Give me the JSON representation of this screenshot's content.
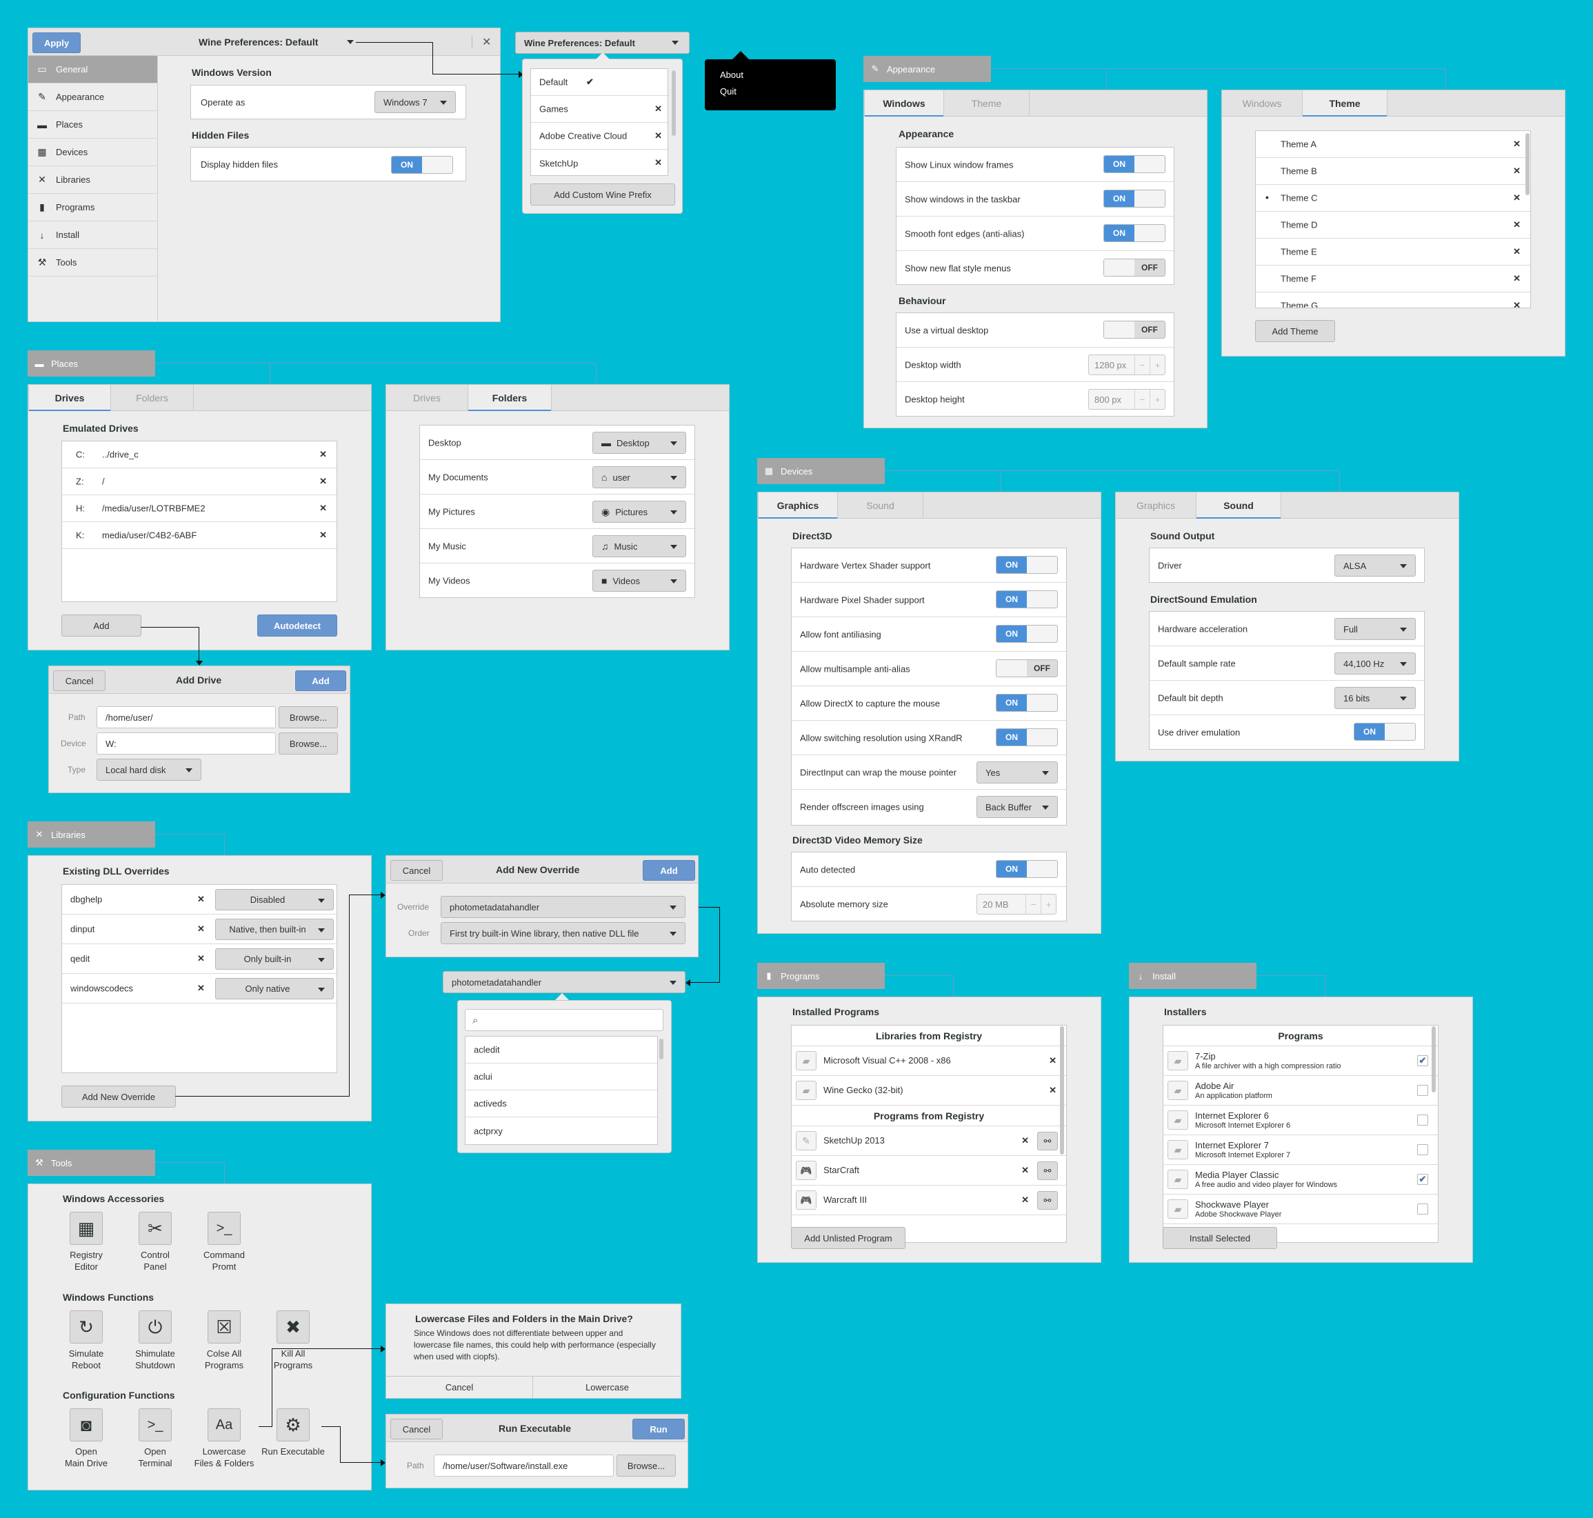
{
  "main_window": {
    "apply": "Apply",
    "title": "Wine Preferences: Default",
    "sidebar": [
      {
        "icon": "monitor-icon",
        "glyph": "▭",
        "label": "General"
      },
      {
        "icon": "brush-icon",
        "glyph": "✎",
        "label": "Appearance"
      },
      {
        "icon": "folder-icon",
        "glyph": "▬",
        "label": "Places"
      },
      {
        "icon": "devices-icon",
        "glyph": "▦",
        "label": "Devices"
      },
      {
        "icon": "tools-icon",
        "glyph": "✕",
        "label": "Libraries"
      },
      {
        "icon": "bag-icon",
        "glyph": "▮",
        "label": "Programs"
      },
      {
        "icon": "download-icon",
        "glyph": "↓",
        "label": "Install"
      },
      {
        "icon": "hammer-icon",
        "glyph": "⚒",
        "label": "Tools"
      }
    ],
    "windows_version": "Windows Version",
    "operate_as": "Operate as",
    "version_value": "Windows 7",
    "hidden_files": "Hidden Files",
    "display_hidden": "Display hidden files",
    "on": "ON"
  },
  "prefix_popover": {
    "button": "Wine Preferences: Default",
    "items": [
      "Default",
      "Games",
      "Adobe Creative Cloud",
      "SketchUp"
    ],
    "check": "✔",
    "add": "Add Custom Wine Prefix"
  },
  "app_menu": {
    "items": [
      "About",
      "Quit"
    ]
  },
  "appearance": {
    "head": "Appearance",
    "tab_windows": "Windows",
    "tab_theme": "Theme",
    "sect_appearance": "Appearance",
    "rows": [
      {
        "label": "Show Linux window frames",
        "state": "ON"
      },
      {
        "label": "Show windows in the taskbar",
        "state": "ON"
      },
      {
        "label": "Smooth font edges (anti-alias)",
        "state": "ON"
      },
      {
        "label": "Show new flat style menus",
        "state": "OFF"
      }
    ],
    "sect_behaviour": "Behaviour",
    "virtual_desktop": "Use a virtual desktop",
    "off": "OFF",
    "desk_width": "Desktop width",
    "width_value": "1280 px",
    "desk_height": "Desktop height",
    "height_value": "800 px",
    "minus": "−",
    "plus": "+",
    "themes": [
      "Theme A",
      "Theme B",
      "Theme C",
      "Theme D",
      "Theme E",
      "Theme F",
      "Theme G"
    ],
    "theme_bullet": "•",
    "add_theme": "Add Theme"
  },
  "places": {
    "head": "Places",
    "tab_drives": "Drives",
    "tab_folders": "Folders",
    "emulated": "Emulated Drives",
    "drives": [
      {
        "letter": "C:",
        "path": "../drive_c"
      },
      {
        "letter": "Z:",
        "path": "/"
      },
      {
        "letter": "H:",
        "path": "/media/user/LOTRBFME2"
      },
      {
        "letter": "K:",
        "path": "media/user/C4B2-6ABF"
      }
    ],
    "add": "Add",
    "autodetect": "Autodetect",
    "folders": [
      {
        "label": "Desktop",
        "value": "Desktop",
        "glyph": "▬"
      },
      {
        "label": "My Documents",
        "value": "user",
        "glyph": "⌂"
      },
      {
        "label": "My Pictures",
        "value": "Pictures",
        "glyph": "◉"
      },
      {
        "label": "My Music",
        "value": "Music",
        "glyph": "♫"
      },
      {
        "label": "My Videos",
        "value": "Videos",
        "glyph": "■"
      }
    ]
  },
  "add_drive": {
    "cancel": "Cancel",
    "title": "Add Drive",
    "add": "Add",
    "path_label": "Path",
    "path_value": "/home/user/",
    "browse": "Browse...",
    "device_label": "Device",
    "device_value": "W:",
    "type_label": "Type",
    "type_value": "Local hard disk"
  },
  "libraries": {
    "head": "Libraries",
    "existing": "Existing DLL Overrides",
    "overrides": [
      {
        "name": "dbghelp",
        "mode": "Disabled"
      },
      {
        "name": "dinput",
        "mode": "Native, then built-in"
      },
      {
        "name": "qedit",
        "mode": "Only built-in"
      },
      {
        "name": "windowscodecs",
        "mode": "Only native"
      }
    ],
    "add_override": "Add New Override"
  },
  "add_override": {
    "cancel": "Cancel",
    "title": "Add New Override",
    "add": "Add",
    "override_label": "Override",
    "override_value": "photometadatahandler",
    "order_label": "Order",
    "order_value": "First try built-in Wine library, then native DLL file"
  },
  "dll_picker": {
    "value": "photometadatahandler",
    "items": [
      "acledit",
      "aclui",
      "activeds",
      "actprxy"
    ]
  },
  "tools": {
    "head": "Tools",
    "accessories": "Windows Accessories",
    "acc_items": [
      {
        "icon": "grid-icon",
        "glyph": "▦",
        "l1": "Registry",
        "l2": "Editor"
      },
      {
        "icon": "tools-icon",
        "glyph": "✂",
        "l1": "Control",
        "l2": "Panel"
      },
      {
        "icon": "terminal-icon",
        "glyph": ">_",
        "l1": "Command",
        "l2": "Promt"
      }
    ],
    "functions": "Windows Functions",
    "fn_items": [
      {
        "icon": "refresh-icon",
        "glyph": "↻",
        "l1": "Simulate",
        "l2": "Reboot"
      },
      {
        "icon": "power-icon",
        "glyph": "⏻",
        "l1": "Shimulate",
        "l2": "Shutdown"
      },
      {
        "icon": "close-box-icon",
        "glyph": "☒",
        "l1": "Colse All",
        "l2": "Programs"
      },
      {
        "icon": "kill-icon",
        "glyph": "✖",
        "l1": "Kill All",
        "l2": "Programs"
      }
    ],
    "config": "Configuration Functions",
    "cfg_items": [
      {
        "icon": "drive-icon",
        "glyph": "◙",
        "l1": "Open",
        "l2": "Main Drive"
      },
      {
        "icon": "terminal-icon",
        "glyph": ">_",
        "l1": "Open",
        "l2": "Terminal"
      },
      {
        "icon": "font-icon",
        "glyph": "Aa",
        "l1": "Lowercase",
        "l2": "Files & Folders"
      },
      {
        "icon": "gears-icon",
        "glyph": "⚙",
        "l1": "Run Executable",
        "l2": ""
      }
    ]
  },
  "lowercase_dialog": {
    "title": "Lowercase Files and Folders in the Main Drive?",
    "body": "Since Windows does not differentiate between upper and lowercase file names, this could help with performance (especially when used with ciopfs).",
    "cancel": "Cancel",
    "confirm": "Lowercase"
  },
  "run_dialog": {
    "cancel": "Cancel",
    "title": "Run Executable",
    "run": "Run",
    "path_label": "Path",
    "path_value": "/home/user/Software/install.exe",
    "browse": "Browse..."
  },
  "devices": {
    "head": "Devices",
    "tab_graphics": "Graphics",
    "tab_sound": "Sound",
    "direct3d": "Direct3D",
    "toggles": [
      {
        "label": "Hardware Vertex Shader support",
        "state": "ON"
      },
      {
        "label": "Hardware Pixel Shader support",
        "state": "ON"
      },
      {
        "label": "Allow font antiliasing",
        "state": "ON"
      },
      {
        "label": "Allow multisample anti-alias",
        "state": "OFF"
      },
      {
        "label": "Allow DirectX to capture the mouse",
        "state": "ON"
      },
      {
        "label": "Allow switching resolution using XRandR",
        "state": "ON"
      }
    ],
    "wrap_label": "DirectInput can wrap the mouse pointer",
    "wrap_value": "Yes",
    "render_label": "Render offscreen images using",
    "render_value": "Back Buffer",
    "vmem": "Direct3D Video Memory Size",
    "auto_detected": "Auto detected",
    "abs_mem": "Absolute memory size",
    "mem_value": "20 MB",
    "sound_output": "Sound Output",
    "driver": "Driver",
    "driver_value": "ALSA",
    "dsound": "DirectSound Emulation",
    "hw_accel": "Hardware acceleration",
    "hw_value": "Full",
    "sample_rate": "Default sample rate",
    "rate_value": "44,100 Hz",
    "bit_depth": "Default bit depth",
    "bit_value": "16 bits",
    "driver_emul": "Use driver emulation"
  },
  "programs": {
    "head": "Programs",
    "installed": "Installed Programs",
    "libs_reg": "Libraries from Registry",
    "libs": [
      "Microsoft Visual C++ 2008 - x86",
      "Wine Gecko (32-bit)"
    ],
    "progs_reg": "Programs from Registry",
    "progs": [
      "SketchUp 2013",
      "StarCraft",
      "Warcraft III"
    ],
    "add_unlisted": "Add Unlisted Program"
  },
  "install": {
    "head": "Install",
    "installers": "Installers",
    "programs_head": "Programs",
    "items": [
      {
        "name": "7-Zip",
        "desc": "A file archiver with a high compression ratio",
        "checked": "✔"
      },
      {
        "name": "Adobe Air",
        "desc": "An application platform",
        "checked": ""
      },
      {
        "name": "Internet Explorer 6",
        "desc": "Microsoft Internet Explorer 6",
        "checked": ""
      },
      {
        "name": "Internet Explorer 7",
        "desc": "Microsoft Internet Explorer 7",
        "checked": ""
      },
      {
        "name": "Media Player Classic",
        "desc": "A free audio and video player for Windows",
        "checked": "✔"
      },
      {
        "name": "Shockwave Player",
        "desc": "Adobe Shockwave Player",
        "checked": ""
      }
    ],
    "install_selected": "Install Selected"
  }
}
